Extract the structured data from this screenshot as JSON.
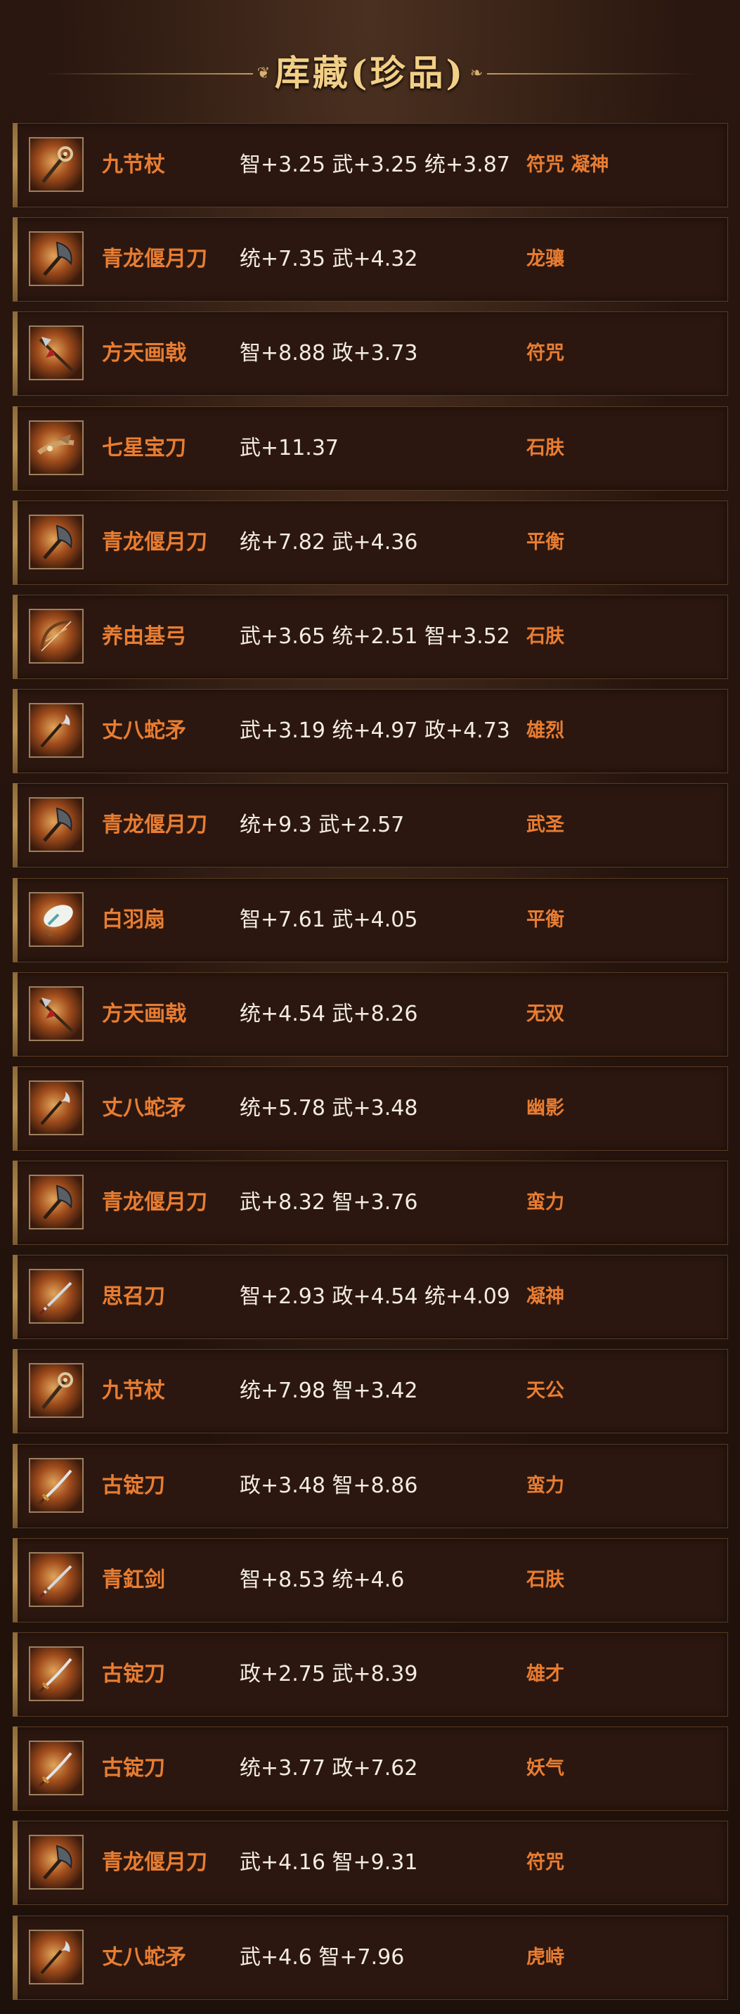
{
  "header": {
    "title": "库藏(珍品)"
  },
  "items": [
    {
      "name": "九节杖",
      "stats": "智+3.25 武+3.25 统+3.87",
      "trait": "符咒 凝神",
      "icon": "staff-icon"
    },
    {
      "name": "青龙偃月刀",
      "stats": "统+7.35 武+4.32",
      "trait": "龙骧",
      "icon": "glaive-icon"
    },
    {
      "name": "方天画戟",
      "stats": "智+8.88 政+3.73",
      "trait": "符咒",
      "icon": "halberd-icon"
    },
    {
      "name": "七星宝刀",
      "stats": "武+11.37",
      "trait": "石肤",
      "icon": "dragon-blade-icon"
    },
    {
      "name": "青龙偃月刀",
      "stats": "统+7.82 武+4.36",
      "trait": "平衡",
      "icon": "glaive-icon"
    },
    {
      "name": "养由基弓",
      "stats": "武+3.65 统+2.51 智+3.52",
      "trait": "石肤",
      "icon": "bow-icon"
    },
    {
      "name": "丈八蛇矛",
      "stats": "武+3.19 统+4.97 政+4.73",
      "trait": "雄烈",
      "icon": "serpent-spear-icon"
    },
    {
      "name": "青龙偃月刀",
      "stats": "统+9.3 武+2.57",
      "trait": "武圣",
      "icon": "glaive-icon"
    },
    {
      "name": "白羽扇",
      "stats": "智+7.61 武+4.05",
      "trait": "平衡",
      "icon": "fan-icon"
    },
    {
      "name": "方天画戟",
      "stats": "统+4.54 武+8.26",
      "trait": "无双",
      "icon": "halberd-icon"
    },
    {
      "name": "丈八蛇矛",
      "stats": "统+5.78 武+3.48",
      "trait": "幽影",
      "icon": "serpent-spear-icon"
    },
    {
      "name": "青龙偃月刀",
      "stats": "武+8.32 智+3.76",
      "trait": "蛮力",
      "icon": "glaive-icon"
    },
    {
      "name": "思召刀",
      "stats": "智+2.93 政+4.54 统+4.09",
      "trait": "凝神",
      "icon": "sword-icon"
    },
    {
      "name": "九节杖",
      "stats": "统+7.98 智+3.42",
      "trait": "天公",
      "icon": "staff-icon"
    },
    {
      "name": "古锭刀",
      "stats": "政+3.48 智+8.86",
      "trait": "蛮力",
      "icon": "saber-icon"
    },
    {
      "name": "青釭剑",
      "stats": "智+8.53 统+4.6",
      "trait": "石肤",
      "icon": "sword-icon"
    },
    {
      "name": "古锭刀",
      "stats": "政+2.75 武+8.39",
      "trait": "雄才",
      "icon": "saber-icon"
    },
    {
      "name": "古锭刀",
      "stats": "统+3.77 政+7.62",
      "trait": "妖气",
      "icon": "saber-icon"
    },
    {
      "name": "青龙偃月刀",
      "stats": "武+4.16 智+9.31",
      "trait": "符咒",
      "icon": "glaive-icon"
    },
    {
      "name": "丈八蛇矛",
      "stats": "武+4.6 智+7.96",
      "trait": "虎峙",
      "icon": "serpent-spear-icon"
    }
  ]
}
